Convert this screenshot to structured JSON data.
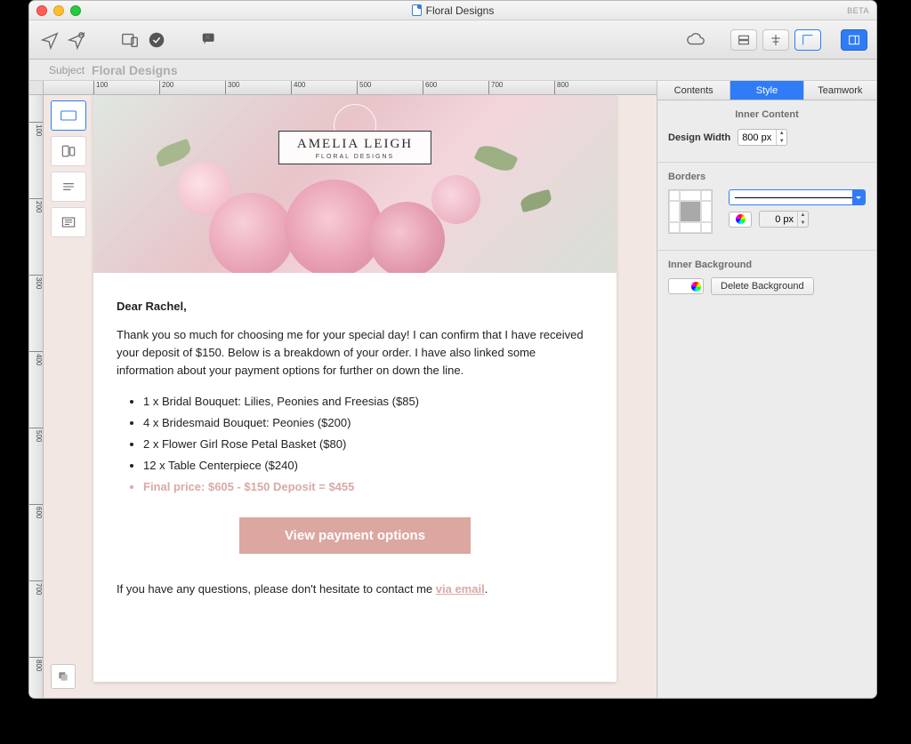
{
  "window": {
    "title": "Floral Designs",
    "beta": "BETA"
  },
  "subject": {
    "label": "Subject",
    "value": "Floral Designs"
  },
  "rulerH": [
    "100",
    "200",
    "300",
    "400",
    "500",
    "600",
    "700",
    "800"
  ],
  "rulerV": [
    "100",
    "200",
    "300",
    "400",
    "500",
    "600",
    "700",
    "800"
  ],
  "hero": {
    "name": "AMELIA LEIGH",
    "sub": "FLORAL DESIGNS"
  },
  "email": {
    "greeting": "Dear Rachel,",
    "p1": "Thank you so much for choosing me for your special day! I can confirm that I have received your deposit of $150. Below is a breakdown of your order. I have also linked some information about your payment options for further on down the line.",
    "items": [
      "1 x Bridal Bouquet: Lilies, Peonies and Freesias ($85)",
      "4 x Bridesmaid Bouquet: Peonies ($200)",
      "2 x Flower Girl Rose Petal Basket ($80)",
      "12 x Table Centerpiece ($240)"
    ],
    "final": "Final price: $605 - $150 Deposit = $455",
    "cta": "View payment options",
    "p2a": "If you have any questions, please don't hesitate to contact me ",
    "link": "via email",
    "p2b": "."
  },
  "panel": {
    "tabs": {
      "contents": "Contents",
      "style": "Style",
      "teamwork": "Teamwork"
    },
    "inner": {
      "heading": "Inner Content",
      "widthLabel": "Design Width",
      "widthValue": "800 px"
    },
    "borders": {
      "heading": "Borders",
      "sizeValue": "0 px"
    },
    "bg": {
      "heading": "Inner Background",
      "delete": "Delete Background"
    }
  }
}
